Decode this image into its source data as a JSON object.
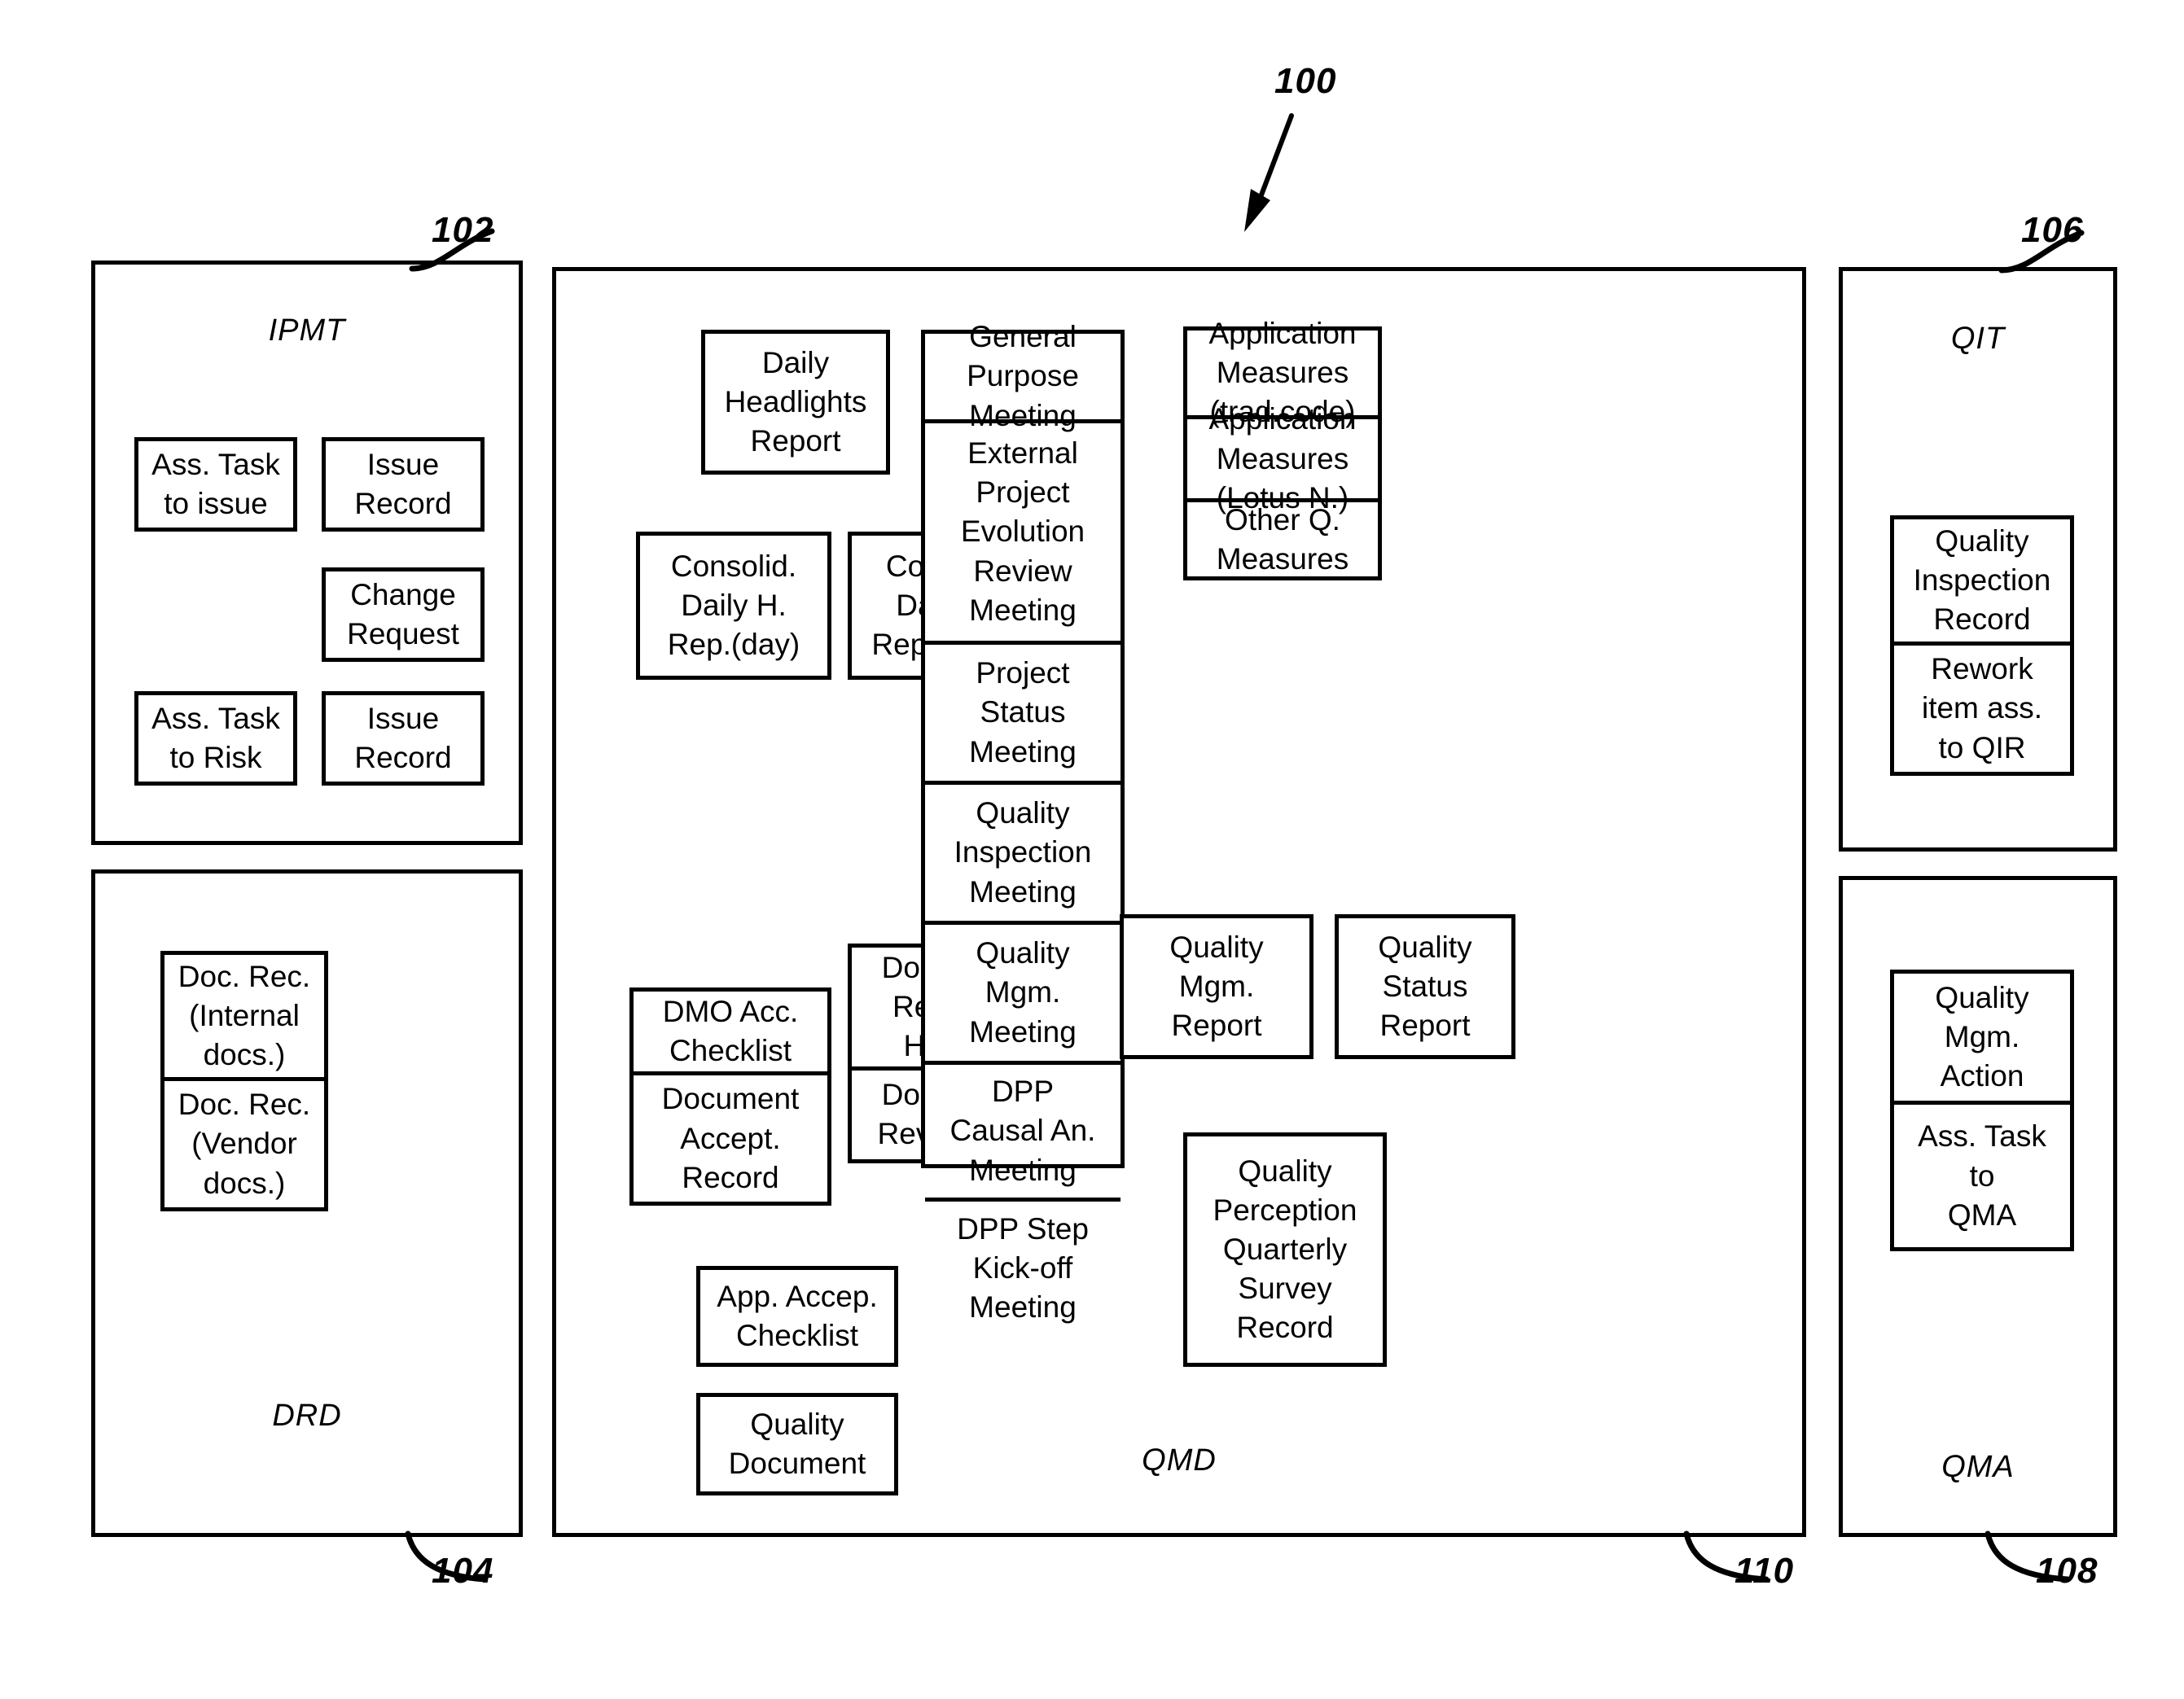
{
  "figure": {
    "number": "100",
    "refs": {
      "ipmt": "102",
      "drd": "104",
      "qit": "106",
      "qma": "108",
      "qmd": "110"
    }
  },
  "panels": {
    "ipmt": {
      "label": "IPMT",
      "boxes": [
        {
          "name": "ass-task-to-issue",
          "lines": [
            "Ass. Task",
            "to issue"
          ]
        },
        {
          "name": "issue-record-top",
          "lines": [
            "Issue",
            "Record"
          ]
        },
        {
          "name": "change-request",
          "lines": [
            "Change",
            "Request"
          ]
        },
        {
          "name": "ass-task-to-risk",
          "lines": [
            "Ass. Task",
            "to Risk"
          ]
        },
        {
          "name": "issue-record-bottom",
          "lines": [
            "Issue",
            "Record"
          ]
        }
      ]
    },
    "drd": {
      "label": "DRD",
      "stack": [
        {
          "name": "doc-rec-internal",
          "lines": [
            "Doc. Rec.",
            "(Internal",
            "docs.)"
          ]
        },
        {
          "name": "doc-rec-vendor",
          "lines": [
            "Doc. Rec.",
            "(Vendor",
            "docs.)"
          ]
        }
      ]
    },
    "qit": {
      "label": "QIT",
      "stack": [
        {
          "name": "quality-inspection-record",
          "lines": [
            "Quality",
            "Inspection",
            "Record"
          ]
        },
        {
          "name": "rework-item-ass-to-qir",
          "lines": [
            "Rework",
            "item ass.",
            "to QIR"
          ]
        }
      ]
    },
    "qma": {
      "label": "QMA",
      "stack": [
        {
          "name": "quality-mgm-action",
          "lines": [
            "Quality",
            "Mgm.",
            "Action"
          ]
        },
        {
          "name": "ass-task-to-qma",
          "lines": [
            "Ass. Task",
            "to",
            "QMA"
          ]
        }
      ]
    },
    "qmd": {
      "label": "QMD",
      "reports": [
        {
          "name": "daily-headlights-report",
          "lines": [
            "Daily",
            "Headlights",
            "Report"
          ]
        },
        {
          "name": "consolid-daily-h-rep-day",
          "lines": [
            "Consolid.",
            "Daily H.",
            "Rep.(day)"
          ]
        },
        {
          "name": "consolid-daily-h-rep-week",
          "lines": [
            "Consolid.",
            "Daily H.",
            "Rep.(week)"
          ]
        }
      ],
      "document_stack": [
        {
          "name": "dmo-acc-checklist",
          "lines": [
            "DMO Acc.",
            "Checklist"
          ]
        },
        {
          "name": "document-accept-record",
          "lines": [
            "Document",
            "Accept.",
            "Record"
          ]
        }
      ],
      "revision_stack": [
        {
          "name": "document-revision-history",
          "lines": [
            "Document",
            "Revision",
            "History"
          ]
        },
        {
          "name": "document-revision-r",
          "lines": [
            "Document",
            "Revision  R"
          ]
        }
      ],
      "checklists": [
        {
          "name": "app-accep-checklist",
          "lines": [
            "App. Accep.",
            "Checklist"
          ]
        },
        {
          "name": "quality-document",
          "lines": [
            "Quality",
            "Document"
          ]
        }
      ],
      "meetings": [
        {
          "name": "general-purpose-meeting",
          "lines": [
            "General",
            "Purpose",
            "Meeting"
          ]
        },
        {
          "name": "external-project-evolution-review-meeting",
          "lines": [
            "External",
            "Project",
            "Evolution",
            "Review",
            "Meeting"
          ]
        },
        {
          "name": "project-status-meeting",
          "lines": [
            "Project",
            "Status",
            "Meeting"
          ]
        },
        {
          "name": "quality-inspection-meeting",
          "lines": [
            "Quality",
            "Inspection",
            "Meeting"
          ]
        },
        {
          "name": "quality-mgm-meeting",
          "lines": [
            "Quality",
            "Mgm.",
            "Meeting"
          ]
        },
        {
          "name": "dpp-causal-an-meeting",
          "lines": [
            "DPP",
            "Causal An.",
            "Meeting"
          ]
        },
        {
          "name": "dpp-step-kick-off-meeting",
          "lines": [
            "DPP Step",
            "Kick-off",
            "Meeting"
          ]
        }
      ],
      "measures": [
        {
          "name": "application-measures-trad-code",
          "lines": [
            "Application",
            "Measures",
            "(trad.code)"
          ]
        },
        {
          "name": "application-measures-lotus-n",
          "lines": [
            "Application",
            "Measures",
            "(Lotus N.)"
          ]
        },
        {
          "name": "other-q-measures",
          "lines": [
            "Other Q.",
            "Measures"
          ]
        }
      ],
      "quality_reports": [
        {
          "name": "quality-mgm-report",
          "lines": [
            "Quality",
            "Mgm.",
            "Report"
          ]
        },
        {
          "name": "quality-status-report",
          "lines": [
            "Quality",
            "Status",
            "Report"
          ]
        }
      ],
      "survey": {
        "name": "quality-perception-quarterly-survey-record",
        "lines": [
          "Quality",
          "Perception",
          "Quarterly",
          "Survey",
          "Record"
        ]
      }
    }
  },
  "colors": {
    "ink": "#000000",
    "paper": "#ffffff"
  }
}
